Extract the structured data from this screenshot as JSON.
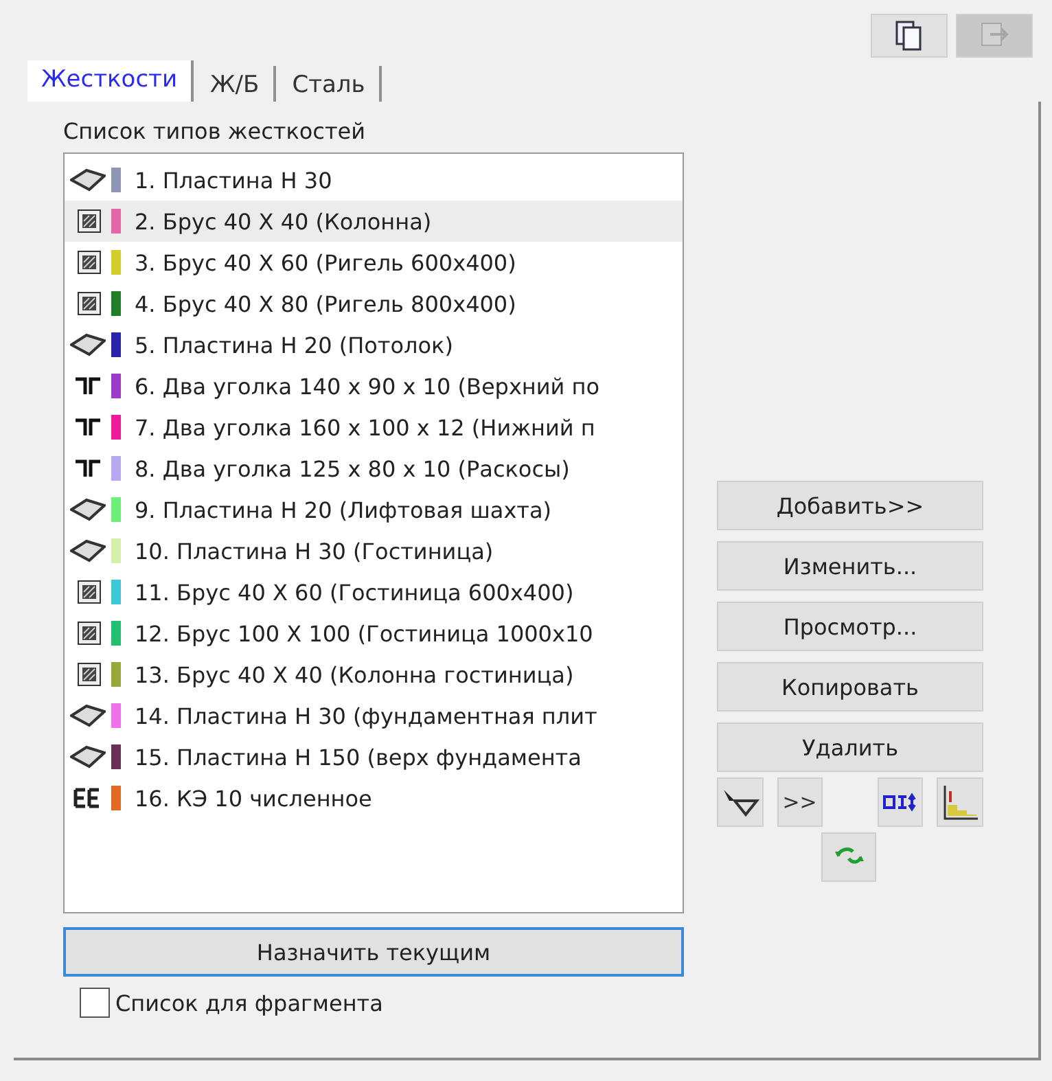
{
  "tabs": [
    {
      "label": "Жесткости",
      "selected": true
    },
    {
      "label": "Ж/Б",
      "selected": false
    },
    {
      "label": "Сталь",
      "selected": false
    }
  ],
  "list_title": "Список типов жесткостей",
  "items": [
    {
      "kind": "plate",
      "color": "#8e95b5",
      "label": "1. Пластина  H 30",
      "selected": false
    },
    {
      "kind": "beam",
      "color": "#e466a8",
      "label": "2. Брус 40 X 40 (Колонна)",
      "selected": true
    },
    {
      "kind": "beam",
      "color": "#d4cc2a",
      "label": "3. Брус 40 X 60 (Ригель 600x400)",
      "selected": false
    },
    {
      "kind": "beam",
      "color": "#1f7f28",
      "label": "4. Брус 40 X 80 (Ригель 800x400)",
      "selected": false
    },
    {
      "kind": "plate",
      "color": "#2a24a8",
      "label": "5. Пластина  H 20 (Потолок)",
      "selected": false
    },
    {
      "kind": "angles",
      "color": "#9a3cc8",
      "label": "6. Два уголка 140 x 90 x 10 (Верхний по",
      "selected": false
    },
    {
      "kind": "angles",
      "color": "#ee1a9a",
      "label": "7. Два уголка 160 x 100 x 12 (Нижний п",
      "selected": false
    },
    {
      "kind": "angles",
      "color": "#b8a8f0",
      "label": "8. Два уголка 125 x 80 x 10 (Раскосы)",
      "selected": false
    },
    {
      "kind": "plate",
      "color": "#6cf078",
      "label": "9. Пластина  H 20 (Лифтовая шахта)",
      "selected": false
    },
    {
      "kind": "plate",
      "color": "#d4f0a8",
      "label": "10. Пластина  H 30 (Гостиница)",
      "selected": false
    },
    {
      "kind": "beam",
      "color": "#3cc8d4",
      "label": "11. Брус 40 X 60 (Гостиница 600x400)",
      "selected": false
    },
    {
      "kind": "beam",
      "color": "#20c070",
      "label": "12. Брус 100 X 100 (Гостиница 1000x10",
      "selected": false
    },
    {
      "kind": "beam",
      "color": "#98a838",
      "label": "13. Брус 40 X 40 (Колонна гостиница)",
      "selected": false
    },
    {
      "kind": "plate",
      "color": "#f070e8",
      "label": "14. Пластина  H 30 (фундаментная плит",
      "selected": false
    },
    {
      "kind": "plate",
      "color": "#6a3058",
      "label": "15. Пластина  H 150 (верх фундамента",
      "selected": false
    },
    {
      "kind": "fe",
      "color": "#e06a20",
      "label": "16. КЭ 10 численное",
      "selected": false
    }
  ],
  "buttons": [
    "Добавить>>",
    "Изменить...",
    "Просмотр...",
    "Копировать",
    "Удалить"
  ],
  "tool_buttons": [
    {
      "kind": "filter"
    },
    {
      "kind": "text",
      "label": ">>"
    },
    {
      "kind": "swap"
    },
    {
      "kind": "steps"
    }
  ],
  "refresh_button": {
    "kind": "refresh"
  },
  "assign_button": "Назначить текущим",
  "fragment_checkbox": {
    "label": "Список для фрагмента",
    "checked": false
  },
  "top_buttons": [
    {
      "kind": "copy",
      "disabled": false
    },
    {
      "kind": "paste",
      "disabled": true
    }
  ]
}
